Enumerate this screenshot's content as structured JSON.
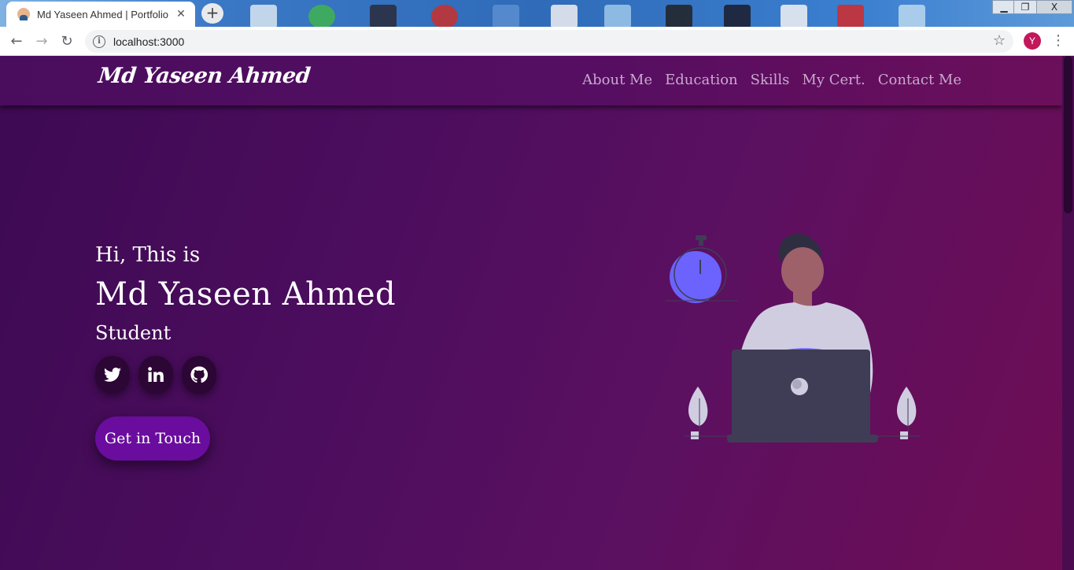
{
  "browser": {
    "tab_title": "Md Yaseen Ahmed | Portfolio",
    "tab_close": "✕",
    "new_tab": "+",
    "url": "localhost:3000",
    "profile_initial": "Y",
    "window_controls": {
      "minimize": "▁",
      "restore": "❐",
      "close": "X"
    },
    "nav_icons": {
      "back": "←",
      "forward": "→",
      "reload": "↻",
      "star": "☆",
      "menu": "⋮",
      "info": "i"
    }
  },
  "site": {
    "brand": "Md Yaseen Ahmed",
    "nav": [
      {
        "label": "About Me"
      },
      {
        "label": "Education"
      },
      {
        "label": "Skills"
      },
      {
        "label": "My Cert."
      },
      {
        "label": "Contact Me"
      }
    ]
  },
  "hero": {
    "greeting": "Hi, This is",
    "name": "Md Yaseen Ahmed",
    "role": "Student",
    "socials": [
      {
        "icon": "twitter-icon"
      },
      {
        "icon": "linkedin-icon"
      },
      {
        "icon": "github-icon"
      }
    ],
    "cta_label": "Get in Touch"
  },
  "colors": {
    "accent": "#6a0d9e",
    "nav_link": "#c9a9cf",
    "background_start": "#3d0a52",
    "background_end": "#6e0d55",
    "social_bg": "#2c0634"
  }
}
